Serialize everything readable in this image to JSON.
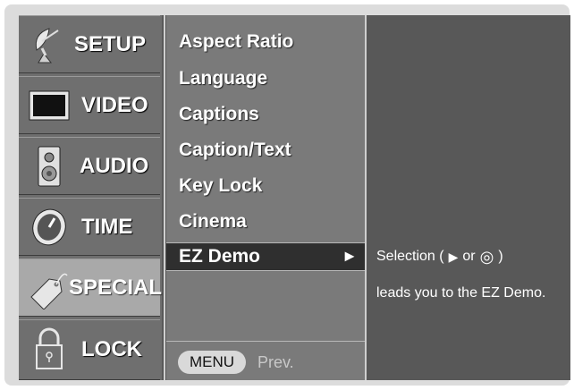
{
  "sidebar": {
    "items": [
      {
        "label": "SETUP",
        "icon": "satellite-dish-icon"
      },
      {
        "label": "VIDEO",
        "icon": "tv-screen-icon"
      },
      {
        "label": "AUDIO",
        "icon": "speaker-icon"
      },
      {
        "label": "TIME",
        "icon": "clock-icon"
      },
      {
        "label": "SPECIAL",
        "icon": "tag-icon"
      },
      {
        "label": "LOCK",
        "icon": "padlock-icon"
      }
    ],
    "active": "SPECIAL"
  },
  "submenu": {
    "items": [
      "Aspect Ratio",
      "Language",
      "Captions",
      "Caption/Text",
      "Key Lock",
      "Cinema"
    ],
    "selected": "EZ Demo",
    "selected_arrow": "►"
  },
  "footer": {
    "menu_label": "MENU",
    "prev_label": "Prev."
  },
  "description": {
    "line1_prefix": "Selection (",
    "line1_arrow": "▶",
    "line1_or": "or",
    "line1_enter": "◎",
    "line1_suffix": ")",
    "line2": "leads you to the EZ Demo."
  },
  "colors": {
    "background": "#585858",
    "active_sidebar": "#a9a9a9",
    "selected_item": "#2f2f2f"
  }
}
